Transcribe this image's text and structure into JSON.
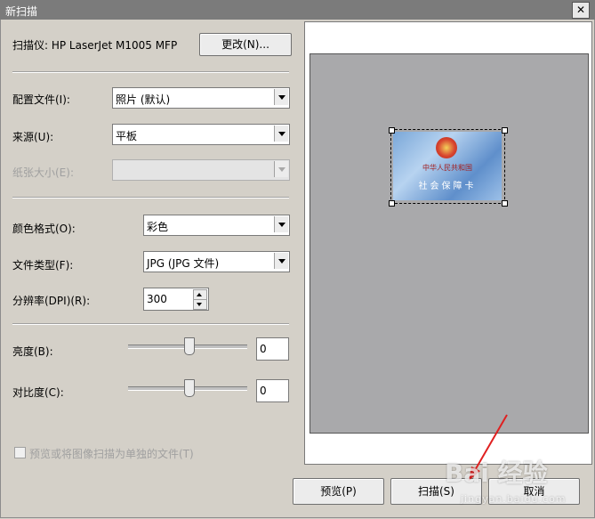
{
  "window": {
    "title": "新扫描",
    "close_symbol": "✕"
  },
  "scanner": {
    "label": "扫描仪: HP LaserJet M1005 MFP",
    "change_button": "更改(N)..."
  },
  "profile": {
    "label": "配置文件(I):",
    "value": "照片 (默认)"
  },
  "source": {
    "label": "来源(U):",
    "value": "平板"
  },
  "paper_size": {
    "label": "纸张大小(E):",
    "value": ""
  },
  "color_format": {
    "label": "颜色格式(O):",
    "value": "彩色"
  },
  "file_type": {
    "label": "文件类型(F):",
    "value": "JPG (JPG 文件)"
  },
  "resolution": {
    "label": "分辨率(DPI)(R):",
    "value": "300"
  },
  "brightness": {
    "label": "亮度(B):",
    "value": "0"
  },
  "contrast": {
    "label": "对比度(C):",
    "value": "0"
  },
  "separate_files": {
    "label": "预览或将图像扫描为单独的文件(T)",
    "checked": false
  },
  "preview_card": {
    "line1": "中华人民共和国",
    "line2": "社会保障卡"
  },
  "buttons": {
    "preview": "预览(P)",
    "scan": "扫描(S)",
    "cancel": "取消"
  },
  "watermark": {
    "brand": "Bai 经验",
    "site": "jingyan.baidu.com"
  },
  "colors": {
    "annotation_arrow": "#e02020",
    "preview_background": "#a9a9ab"
  }
}
